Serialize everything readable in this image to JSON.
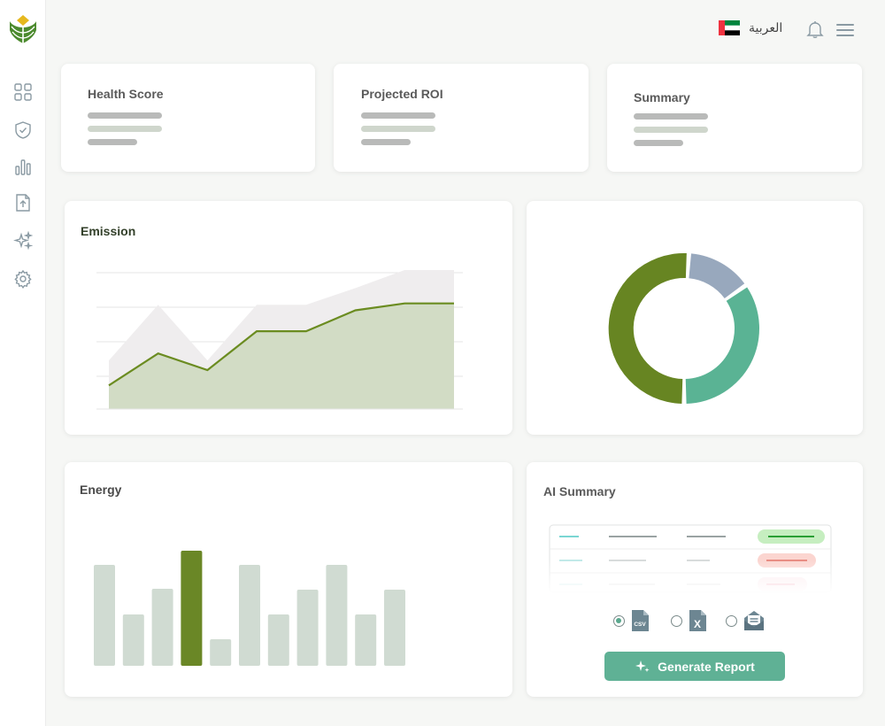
{
  "topbar": {
    "language_label": "العربية"
  },
  "kpis": [
    {
      "title": "Health Score"
    },
    {
      "title": "Projected ROI"
    },
    {
      "title": "Summary"
    }
  ],
  "emission": {
    "title": "Emission",
    "chart_data": {
      "type": "area",
      "title": "Emission",
      "x": [
        1,
        2,
        3,
        4,
        5,
        6,
        7,
        8
      ],
      "series": [
        {
          "values": [
            0.35,
            0.75,
            0.35,
            0.75,
            0.75,
            0.87,
            1.0,
            1.0
          ]
        },
        {
          "values": [
            0.17,
            0.4,
            0.28,
            0.56,
            0.56,
            0.71,
            0.76,
            0.76
          ]
        }
      ],
      "colors": [
        "#efedee",
        "#6b8c21"
      ],
      "fill": "#d2dcc5",
      "grid": true
    }
  },
  "donut": {
    "chart_data": {
      "type": "pie",
      "values": [
        50,
        14,
        34
      ],
      "colors": [
        "#678522",
        "#98a8bd",
        "#5ab394"
      ]
    }
  },
  "energy": {
    "title": "Energy",
    "chart_data": {
      "type": "bar",
      "values": [
        114,
        58,
        87,
        130,
        30,
        114,
        58,
        86,
        114,
        58,
        86
      ],
      "highlight_index": 3,
      "colors": {
        "bar": "#d0dbd2",
        "highlight": "#6a8726"
      }
    }
  },
  "ai_summary": {
    "title": "AI Summary",
    "formats": [
      {
        "icon": "csv-file-icon",
        "label": "CSV",
        "selected": true
      },
      {
        "icon": "excel-file-icon",
        "label": "X",
        "selected": false
      },
      {
        "icon": "email-icon",
        "selected": false
      }
    ],
    "button_label": "Generate Report"
  },
  "colors": {
    "brand_green": "#6a8726",
    "teal": "#5fb195",
    "slate": "#98a8bd"
  }
}
